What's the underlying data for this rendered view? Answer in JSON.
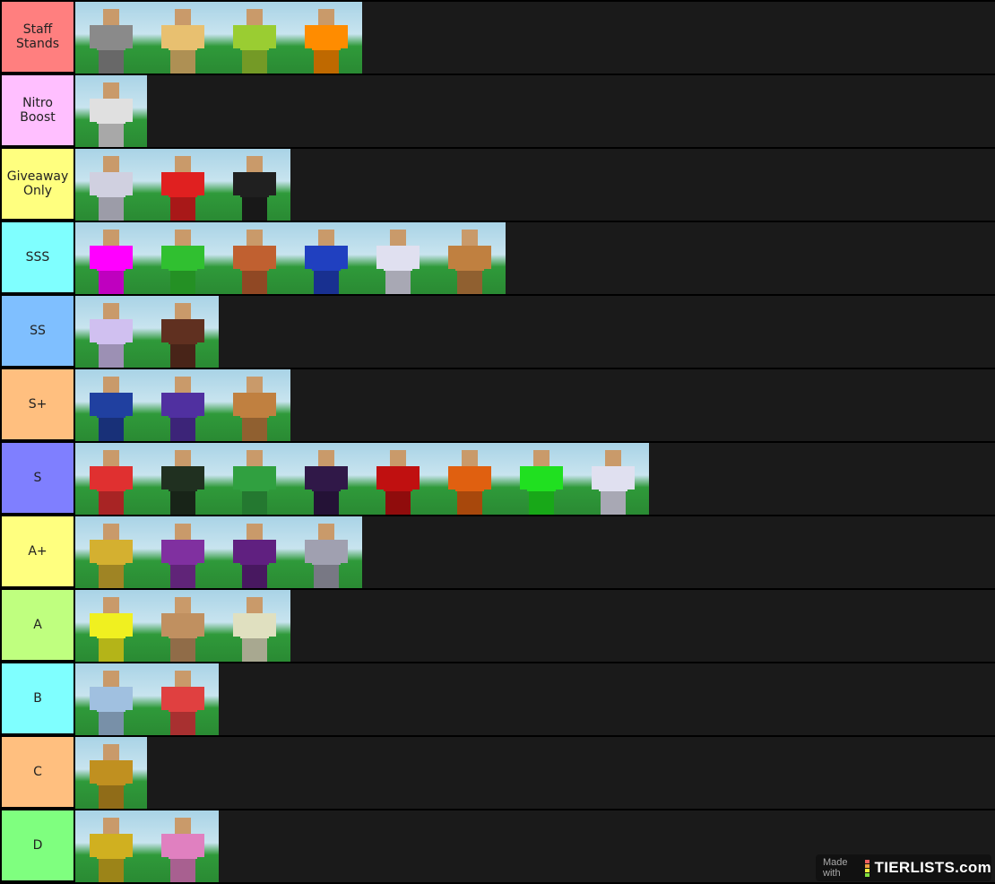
{
  "tiers": [
    {
      "label": "Staff\nStands",
      "color": "#ff7f7f",
      "items": [
        "#8a8a8a",
        "#e8c070",
        "#9acd32",
        "#ff8c00"
      ]
    },
    {
      "label": "Nitro\nBoost",
      "color": "#ffbfff",
      "items": [
        "#e0e0e0"
      ]
    },
    {
      "label": "Giveaway\nOnly",
      "color": "#ffff7f",
      "items": [
        "#d0d0e0",
        "#e02020",
        "#202020"
      ]
    },
    {
      "label": "SSS",
      "color": "#7fffff",
      "items": [
        "#ff00ff",
        "#30c030",
        "#c06030",
        "#2040c0",
        "#e0e0f0",
        "#c08040"
      ]
    },
    {
      "label": "SS",
      "color": "#7fbfff",
      "items": [
        "#d0c0f0",
        "#603020"
      ]
    },
    {
      "label": "S+",
      "color": "#ffbf7f",
      "items": [
        "#2040a0",
        "#5030a0",
        "#c08040"
      ]
    },
    {
      "label": "S",
      "color": "#7f7fff",
      "items": [
        "#e03030",
        "#203020",
        "#30a040",
        "#301848",
        "#c01010",
        "#e06010",
        "#20e020",
        "#e0e0f0"
      ]
    },
    {
      "label": "A+",
      "color": "#ffff7f",
      "items": [
        "#d4b030",
        "#8030a0",
        "#602080",
        "#a0a0b0"
      ]
    },
    {
      "label": "A",
      "color": "#bfff7f",
      "items": [
        "#f0f020",
        "#c09060",
        "#e0e0c0"
      ]
    },
    {
      "label": "B",
      "color": "#7fffff",
      "items": [
        "#a0c0e0",
        "#e04040"
      ]
    },
    {
      "label": "C",
      "color": "#ffbf7f",
      "items": [
        "#c09020"
      ]
    },
    {
      "label": "D",
      "color": "#7fff7f",
      "items": [
        "#d0b020",
        "#e080c0"
      ]
    }
  ],
  "watermark": {
    "prefix": "Made with",
    "brand": "TIERLISTS.com",
    "bar_colors": [
      "#f06060",
      "#f0a040",
      "#f0f040",
      "#80e040"
    ]
  }
}
